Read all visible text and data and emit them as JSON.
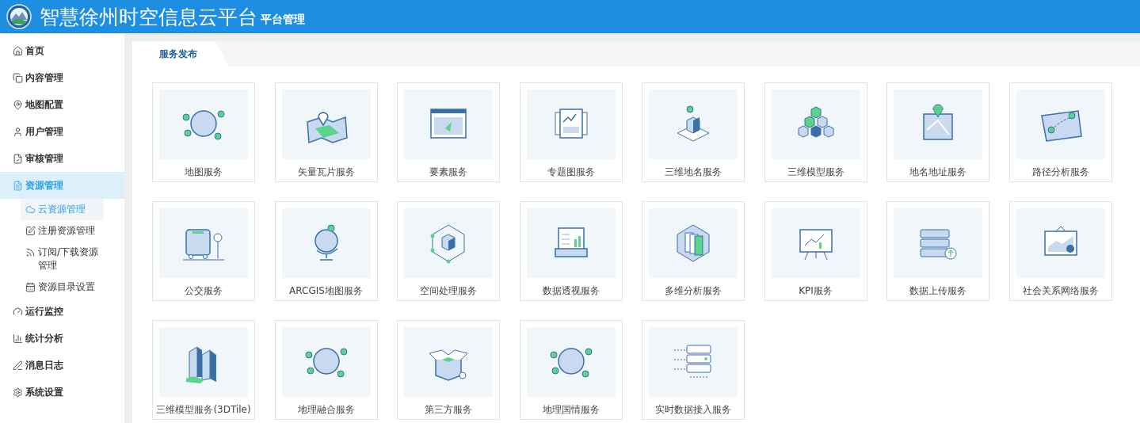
{
  "header": {
    "title": "智慧徐州时空信息云平台",
    "subtitle": "平台管理"
  },
  "sidebar": {
    "items": [
      {
        "label": "首页",
        "selected": false
      },
      {
        "label": "内容管理",
        "selected": false
      },
      {
        "label": "地图配置",
        "selected": false
      },
      {
        "label": "用户管理",
        "selected": false
      },
      {
        "label": "审核管理",
        "selected": false
      },
      {
        "label": "资源管理",
        "selected": true,
        "expanded": true,
        "children": [
          {
            "label": "云资源管理",
            "selected": true
          },
          {
            "label": "注册资源管理",
            "selected": false
          },
          {
            "label": "订阅/下载资源管理",
            "selected": false
          },
          {
            "label": "资源目录设置",
            "selected": false
          }
        ]
      },
      {
        "label": "运行监控",
        "selected": false
      },
      {
        "label": "统计分析",
        "selected": false
      },
      {
        "label": "消息日志",
        "selected": false
      },
      {
        "label": "系统设置",
        "selected": false
      }
    ]
  },
  "tabs": [
    {
      "label": "服务发布",
      "selected": true
    }
  ],
  "services": [
    {
      "label": "地图服务"
    },
    {
      "label": "矢量瓦片服务"
    },
    {
      "label": "要素服务"
    },
    {
      "label": "专题图服务"
    },
    {
      "label": "三维地名服务"
    },
    {
      "label": "三维模型服务"
    },
    {
      "label": "地名地址服务"
    },
    {
      "label": "路径分析服务"
    },
    {
      "label": "公交服务"
    },
    {
      "label": "ARCGIS地图服务"
    },
    {
      "label": "空间处理服务"
    },
    {
      "label": "数据透视服务"
    },
    {
      "label": "多维分析服务"
    },
    {
      "label": "KPI服务"
    },
    {
      "label": "数据上传服务"
    },
    {
      "label": "社会关系网络服务"
    },
    {
      "label": "三维模型服务(3DTile)"
    },
    {
      "label": "地理融合服务"
    },
    {
      "label": "第三方服务"
    },
    {
      "label": "地理国情服务"
    },
    {
      "label": "实时数据接入服务"
    }
  ]
}
